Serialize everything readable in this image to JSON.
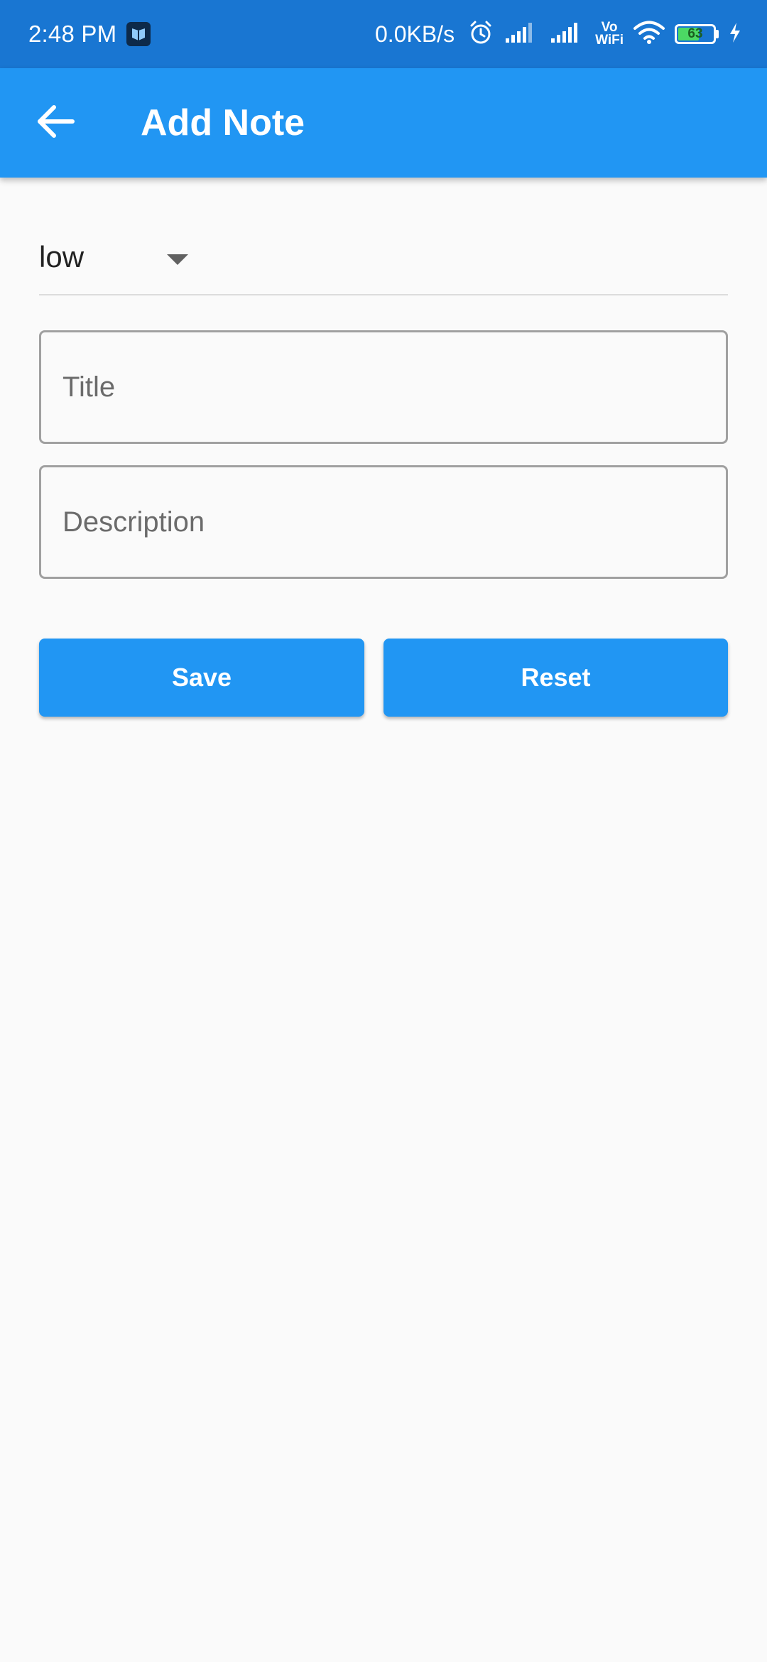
{
  "status_bar": {
    "time": "2:48 PM",
    "network_speed": "0.0KB/s",
    "vowifi_top": "Vo",
    "vowifi_bottom": "WiFi",
    "battery_level": "63",
    "battery_fraction": 0.63,
    "icons": [
      "app-shield-icon",
      "alarm-icon",
      "signal-icon",
      "signal-icon",
      "wifi-icon",
      "battery-icon",
      "charging-icon"
    ]
  },
  "app_bar": {
    "title": "Add Note",
    "back_icon": "arrow-back-icon",
    "color": "#2196f3"
  },
  "form": {
    "priority": {
      "selected": "low"
    },
    "title": {
      "value": "",
      "placeholder": "Title"
    },
    "description": {
      "value": "",
      "placeholder": "Description"
    },
    "save_label": "Save",
    "reset_label": "Reset"
  },
  "colors": {
    "status_bar": "#1976d2",
    "primary": "#2196f3",
    "background": "#fafafa"
  }
}
